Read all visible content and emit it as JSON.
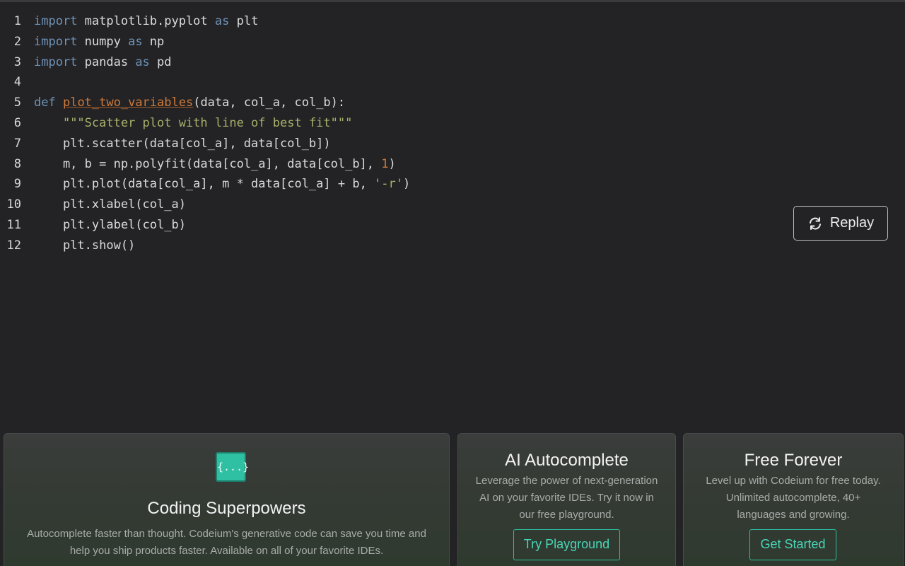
{
  "editor": {
    "lines": [
      {
        "num": "1",
        "tokens": [
          {
            "t": "import",
            "c": "kw"
          },
          {
            "t": " matplotlib.pyplot ",
            "c": ""
          },
          {
            "t": "as",
            "c": "kw"
          },
          {
            "t": " plt",
            "c": ""
          }
        ]
      },
      {
        "num": "2",
        "tokens": [
          {
            "t": "import",
            "c": "kw"
          },
          {
            "t": " numpy ",
            "c": ""
          },
          {
            "t": "as",
            "c": "kw"
          },
          {
            "t": " np",
            "c": ""
          }
        ]
      },
      {
        "num": "3",
        "tokens": [
          {
            "t": "import",
            "c": "kw"
          },
          {
            "t": " pandas ",
            "c": ""
          },
          {
            "t": "as",
            "c": "kw"
          },
          {
            "t": " pd",
            "c": ""
          }
        ]
      },
      {
        "num": "4",
        "tokens": []
      },
      {
        "num": "5",
        "tokens": [
          {
            "t": "def",
            "c": "kw"
          },
          {
            "t": " ",
            "c": ""
          },
          {
            "t": "plot_two_variables",
            "c": "fn"
          },
          {
            "t": "(data, col_a, col_b):",
            "c": ""
          }
        ]
      },
      {
        "num": "6",
        "tokens": [
          {
            "t": "    ",
            "c": ""
          },
          {
            "t": "\"\"\"Scatter plot with line of best fit\"\"\"",
            "c": "str"
          }
        ]
      },
      {
        "num": "7",
        "tokens": [
          {
            "t": "    plt.scatter(data[col_a], data[col_b])",
            "c": ""
          }
        ]
      },
      {
        "num": "8",
        "tokens": [
          {
            "t": "    m, b = np.polyfit(data[col_a], data[col_b], ",
            "c": ""
          },
          {
            "t": "1",
            "c": "num"
          },
          {
            "t": ")",
            "c": ""
          }
        ]
      },
      {
        "num": "9",
        "tokens": [
          {
            "t": "    plt.plot(data[col_a], m * data[col_a] + b, ",
            "c": ""
          },
          {
            "t": "'-r'",
            "c": "str"
          },
          {
            "t": ")",
            "c": ""
          }
        ]
      },
      {
        "num": "10",
        "tokens": [
          {
            "t": "    plt.xlabel(col_a)",
            "c": ""
          }
        ]
      },
      {
        "num": "11",
        "tokens": [
          {
            "t": "    plt.ylabel(col_b)",
            "c": ""
          }
        ]
      },
      {
        "num": "12",
        "tokens": [
          {
            "t": "    plt.show()",
            "c": ""
          }
        ]
      }
    ]
  },
  "replay": {
    "label": "Replay",
    "icon": "refresh-icon"
  },
  "cards": {
    "coding": {
      "icon": "code-braces-icon",
      "icon_text": "{...}",
      "title": "Coding Superpowers",
      "desc_1": "Autocomplete faster than thought. Codeium's generative code can save you time and",
      "desc_2": "help you ship products faster. Available on all of your favorite IDEs."
    },
    "autocomplete": {
      "title": "AI Autocomplete",
      "desc_1": "Leverage the power of next-generation",
      "desc_2": "AI on your favorite IDEs. Try it now in",
      "desc_3": "our free playground.",
      "button": "Try Playground"
    },
    "free": {
      "title": "Free Forever",
      "desc_1": "Level up with Codeium for free today.",
      "desc_2": "Unlimited autocomplete, 40+",
      "desc_3": "languages and growing.",
      "button": "Get Started"
    }
  },
  "colors": {
    "background": "#232325",
    "keyword": "#6e93b8",
    "function": "#d07a3a",
    "string": "#a8b06a",
    "accent": "#2fbfa2"
  }
}
